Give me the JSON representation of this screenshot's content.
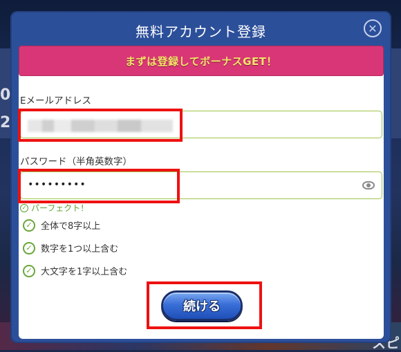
{
  "modal": {
    "title": "無料アカウント登録",
    "close_icon": "close-icon",
    "promo_text": "まずは登録してボーナスGET！"
  },
  "form": {
    "email_label": "Eメールアドレス",
    "password_label": "パスワード（半角英数字）",
    "password_value": "•••••••••",
    "password_status": "パーフェクト！",
    "rules": [
      {
        "text": "全体で8字以上"
      },
      {
        "text": "数字を1つ以上含む"
      },
      {
        "text": "大文字を1字以上含む"
      }
    ],
    "submit_label": "続ける"
  },
  "colors": {
    "header_blue": "#2c4f9a",
    "promo_pink": "#d83676",
    "promo_text": "#f7e56a",
    "input_border": "#9fc24a",
    "check_green": "#6aa63a",
    "highlight_red": "#ee1111"
  },
  "background": {
    "left_fragments": [
      "0",
      "2"
    ],
    "right_fragments": [
      "スピ"
    ]
  }
}
